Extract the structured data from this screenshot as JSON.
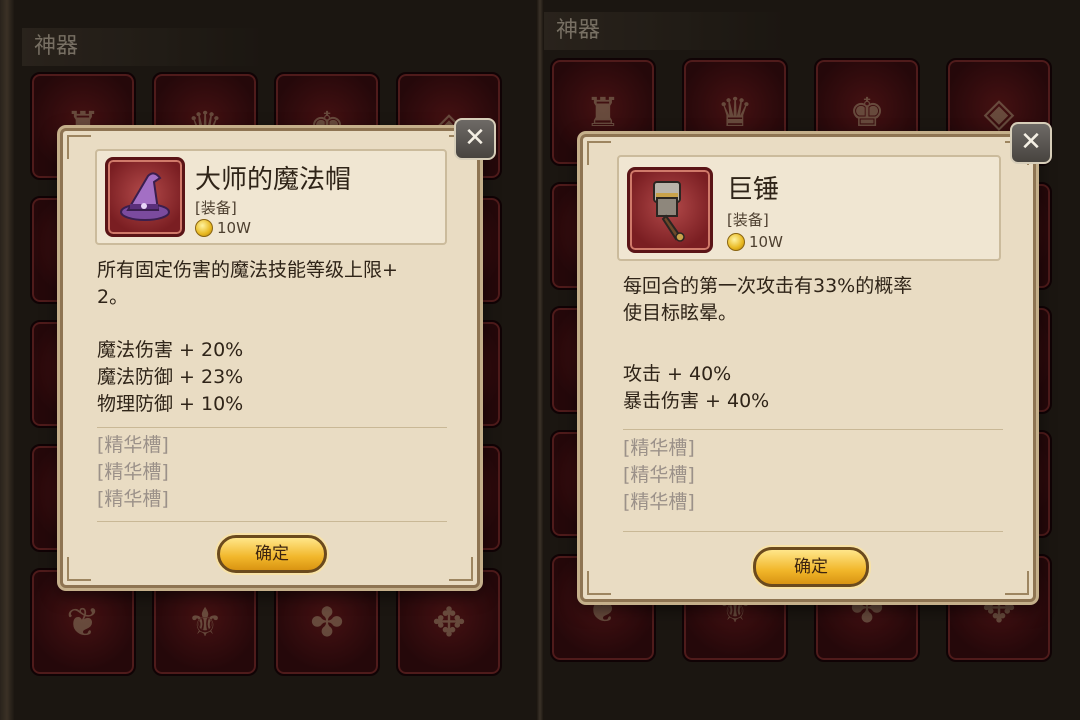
{
  "left": {
    "section_title": "神器",
    "popup": {
      "name": "大师的魔法帽",
      "type": "[装备]",
      "price": "10W",
      "description": [
        "所有固定伤害的魔法技能等级上限+",
        "2。"
      ],
      "stats": [
        "魔法伤害 + 20%",
        "魔法防御 + 23%",
        "物理防御 + 10%"
      ],
      "essence_slots": [
        "[精华槽]",
        "[精华槽]",
        "[精华槽]"
      ],
      "confirm_label": "确定",
      "icon": "wizard-hat-icon"
    }
  },
  "right": {
    "section_title": "神器",
    "popup": {
      "name": "巨锤",
      "type": "[装备]",
      "price": "10W",
      "description": [
        "每回合的第一次攻击有33%的概率",
        "使目标眩晕。"
      ],
      "stats": [
        "攻击 + 40%",
        "暴击伤害 + 40%"
      ],
      "essence_slots": [
        "[精华槽]",
        "[精华槽]",
        "[精华槽]"
      ],
      "confirm_label": "确定",
      "icon": "giant-hammer-icon"
    }
  },
  "close_icon": "close-icon",
  "colors": {
    "parchment": "#e9dcc3",
    "slot_red": "#6a1a1c",
    "button_gold": "#f1b62a",
    "essence_gray": "#9b9189"
  }
}
